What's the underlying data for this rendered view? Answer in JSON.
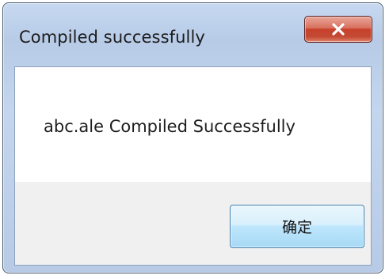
{
  "window": {
    "title": "Compiled successfully",
    "close_icon": "close-icon"
  },
  "message": {
    "text": "abc.ale Compiled Successfully"
  },
  "buttons": {
    "ok_label": "确定"
  },
  "colors": {
    "close_button": "#c7412b",
    "ok_button_border": "#3c7fb1",
    "frame": "#b7cbe7"
  }
}
